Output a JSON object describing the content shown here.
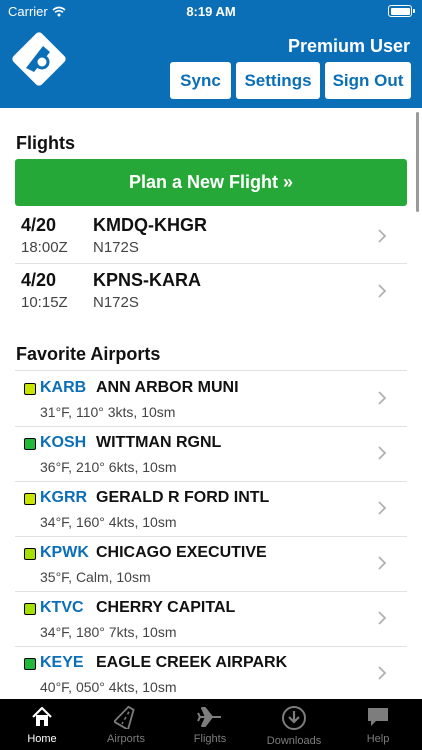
{
  "status_bar": {
    "carrier": "Carrier",
    "time": "8:19 AM"
  },
  "header": {
    "user": "Premium User",
    "buttons": {
      "sync": "Sync",
      "settings": "Settings",
      "sign_out": "Sign Out"
    }
  },
  "flights": {
    "title": "Flights",
    "plan_button": "Plan a New Flight »",
    "items": [
      {
        "date": "4/20",
        "time": "18:00Z",
        "route": "KMDQ-KHGR",
        "tail": "N172S"
      },
      {
        "date": "4/20",
        "time": "10:15Z",
        "route": "KPNS-KARA",
        "tail": "N172S"
      }
    ]
  },
  "favorites": {
    "title": "Favorite Airports",
    "items": [
      {
        "code": "KARB",
        "name": "ANN ARBOR MUNI",
        "weather": "31°F, 110° 3kts, 10sm",
        "status_color": "#c9e400"
      },
      {
        "code": "KOSH",
        "name": "WITTMAN RGNL",
        "weather": "36°F, 210° 6kts, 10sm",
        "status_color": "#22b83a"
      },
      {
        "code": "KGRR",
        "name": "GERALD R FORD INTL",
        "weather": "34°F, 160° 4kts, 10sm",
        "status_color": "#c9e400"
      },
      {
        "code": "KPWK",
        "name": "CHICAGO EXECUTIVE",
        "weather": "35°F, Calm, 10sm",
        "status_color": "#a5e000"
      },
      {
        "code": "KTVC",
        "name": "CHERRY CAPITAL",
        "weather": "34°F, 180° 7kts, 10sm",
        "status_color": "#a5e000"
      },
      {
        "code": "KEYE",
        "name": "EAGLE CREEK AIRPARK",
        "weather": "40°F, 050° 4kts, 10sm",
        "status_color": "#22b83a"
      }
    ]
  },
  "tabs": [
    {
      "label": "Home",
      "icon": "home-icon"
    },
    {
      "label": "Airports",
      "icon": "runway-icon"
    },
    {
      "label": "Flights",
      "icon": "airplane-icon"
    },
    {
      "label": "Downloads",
      "icon": "download-icon"
    },
    {
      "label": "Help",
      "icon": "chat-bubble-icon"
    }
  ],
  "colors": {
    "brand_blue": "#0b6fb8",
    "plan_green": "#25a837",
    "tab_active": "#ffffff",
    "tab_inactive": "#7d7d7d"
  }
}
